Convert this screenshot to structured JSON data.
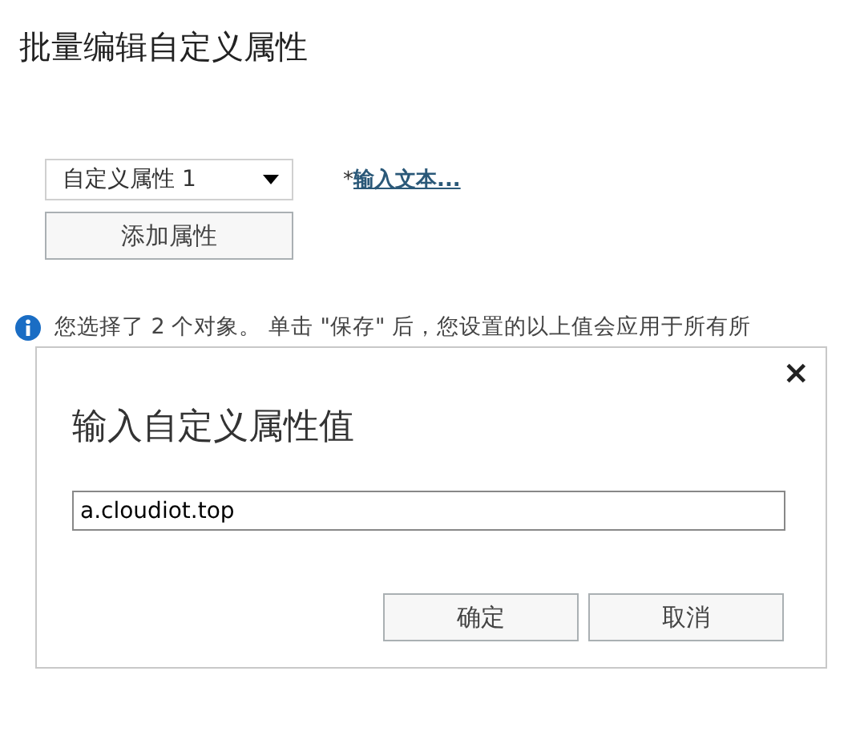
{
  "page": {
    "title": "批量编辑自定义属性"
  },
  "attribute_select": {
    "value": "自定义属性 1"
  },
  "value_link": {
    "required_mark": "*",
    "text": "输入文本..."
  },
  "add_button": "添加属性",
  "info": "您选择了 2 个对象。 单击 \"保存\" 后，您设置的以上值会应用于所有所",
  "dialog": {
    "close": "×",
    "title": "输入自定义属性值",
    "input_value": "a.cloudiot.top",
    "buttons": [
      "确定",
      "取消"
    ]
  }
}
